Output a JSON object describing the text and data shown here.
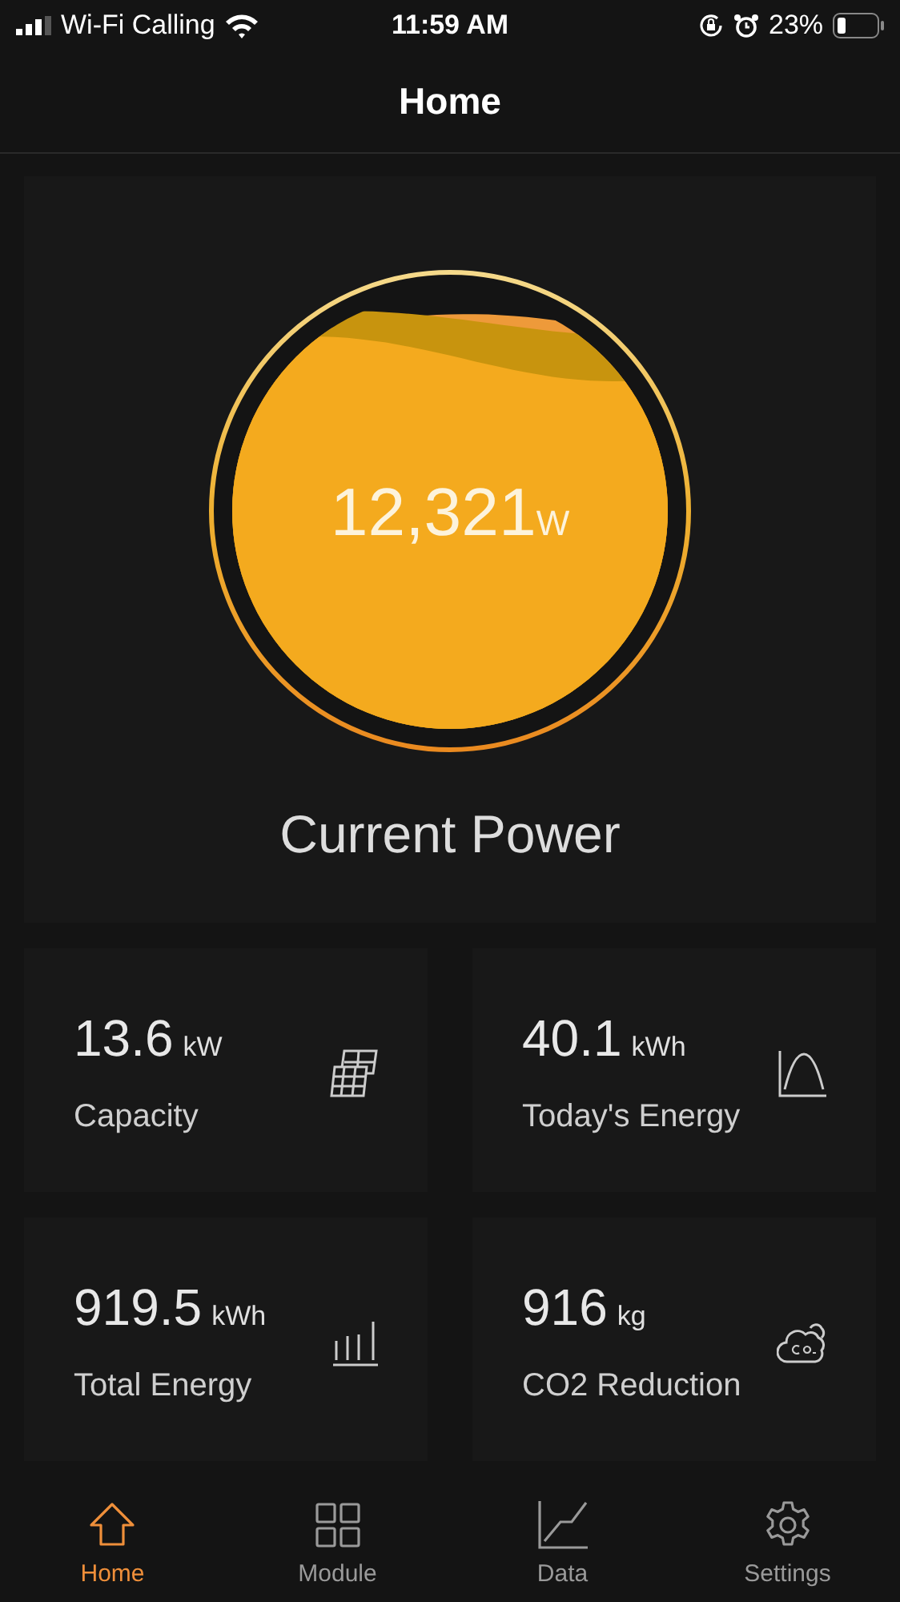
{
  "status_bar": {
    "carrier": "Wi-Fi Calling",
    "time": "11:59 AM",
    "battery": "23%"
  },
  "header": {
    "title": "Home"
  },
  "power": {
    "value": "12,321",
    "unit": "W",
    "label": "Current Power"
  },
  "stats": [
    {
      "kind": "panels",
      "value": "13.6",
      "unit": "kW",
      "label": "Capacity"
    },
    {
      "kind": "curve",
      "value": "40.1",
      "unit": "kWh",
      "label": "Today's Energy"
    },
    {
      "kind": "bars",
      "value": "919.5",
      "unit": "kWh",
      "label": "Total Energy"
    },
    {
      "kind": "cloud",
      "value": "916",
      "unit": "kg",
      "label": "CO2 Reduction"
    }
  ],
  "tabs": [
    {
      "kind": "home",
      "label": "Home",
      "selected": true
    },
    {
      "kind": "grid",
      "label": "Module",
      "selected": false
    },
    {
      "kind": "chart",
      "label": "Data",
      "selected": false
    },
    {
      "kind": "gear",
      "label": "Settings",
      "selected": false
    }
  ]
}
